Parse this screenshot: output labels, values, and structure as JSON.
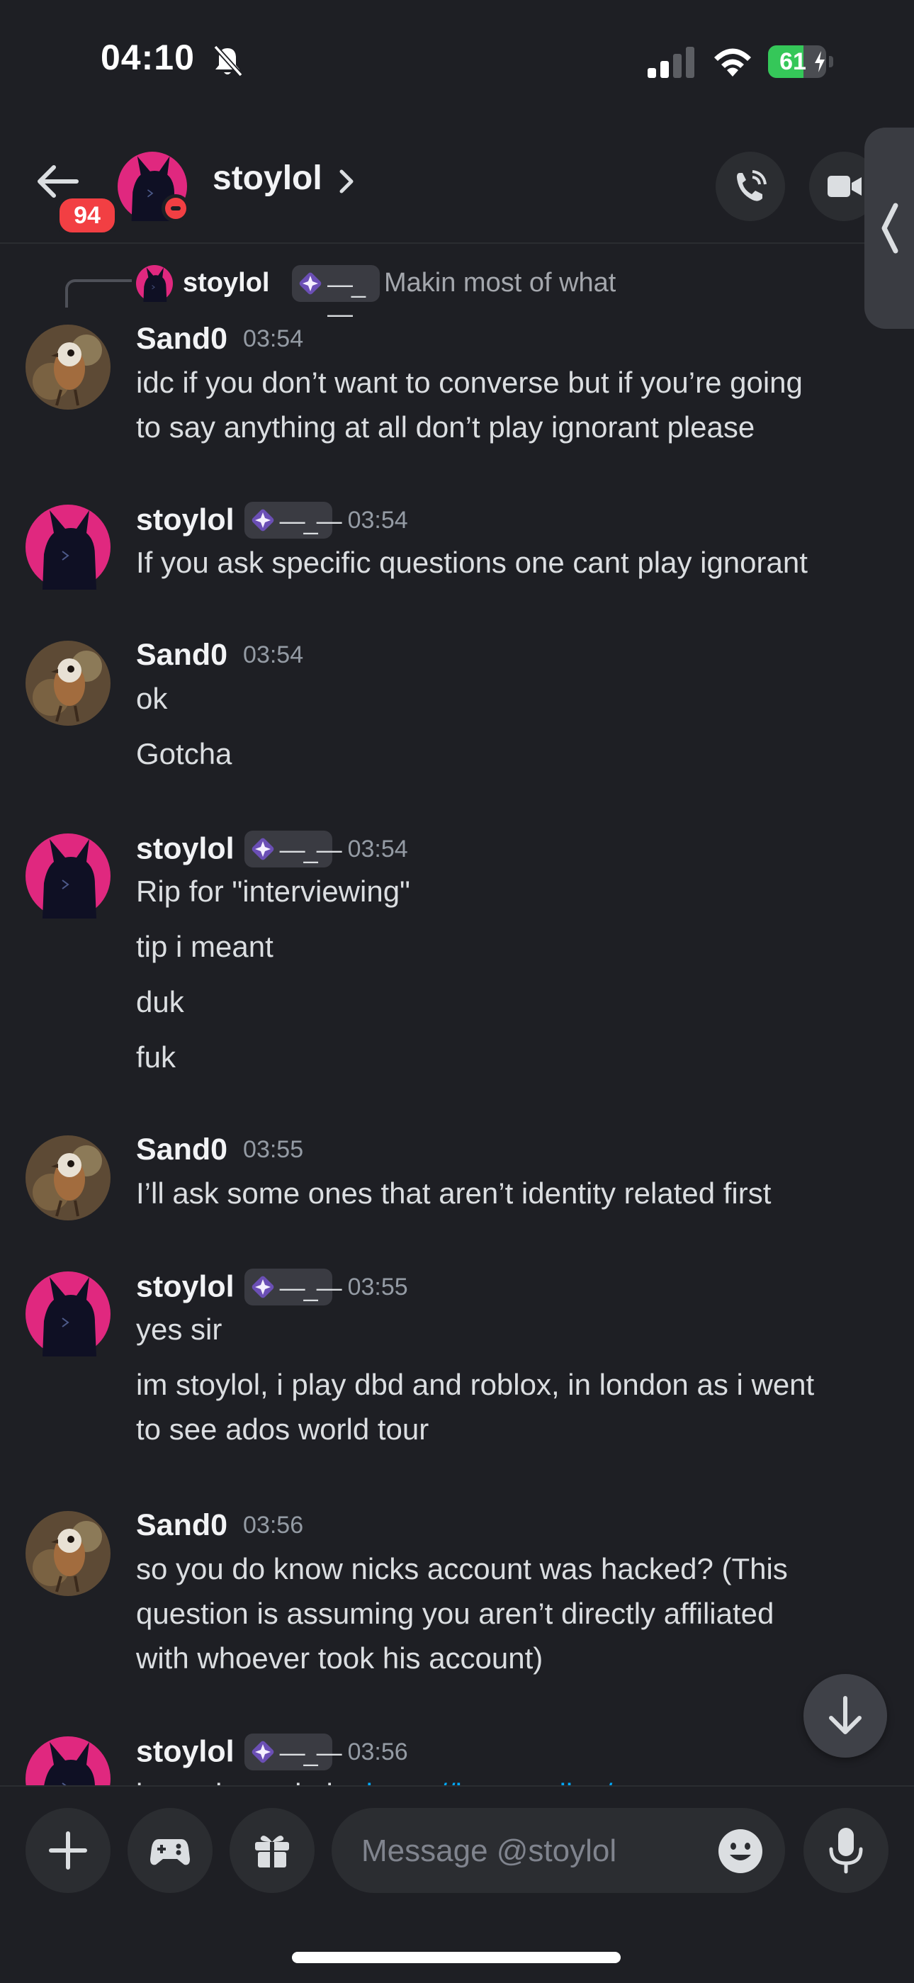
{
  "status_bar": {
    "time": "04:10",
    "battery": "61",
    "battery_level_percent": 61
  },
  "header": {
    "unread_count": "94",
    "username": "stoylol",
    "status": "do-not-disturb",
    "icons": [
      "back-arrow-icon",
      "chevron-right-icon",
      "phone-call-icon",
      "video-camera-icon"
    ]
  },
  "reply_preview": {
    "author": "stoylol",
    "tag": "—_—",
    "text": "Makin most of what"
  },
  "messages": [
    {
      "author": "Sand0",
      "time": "03:54",
      "has_tag": false,
      "lines": [
        "idc if you don’t want to converse but if you’re going",
        "to say anything at all don’t play ignorant please"
      ]
    },
    {
      "author": "stoylol",
      "tag": "—_—",
      "time": "03:54",
      "has_tag": true,
      "lines": [
        "If you ask specific questions one cant play ignorant"
      ]
    },
    {
      "author": "Sand0",
      "time": "03:54",
      "has_tag": false,
      "lines": [
        "ok",
        "Gotcha"
      ]
    },
    {
      "author": "stoylol",
      "tag": "—_—",
      "time": "03:54",
      "has_tag": true,
      "lines": [
        "Rip for \"interviewing\"",
        "tip i meant",
        "duk",
        "fuk"
      ]
    },
    {
      "author": "Sand0",
      "time": "03:55",
      "has_tag": false,
      "lines": [
        "I’ll ask some ones that aren’t identity related first"
      ]
    },
    {
      "author": "stoylol",
      "tag": "—_—",
      "time": "03:55",
      "has_tag": true,
      "lines": [
        "yes sir",
        "im stoylol, i play dbd and roblox, in london as i went",
        "to see ados world tour"
      ]
    },
    {
      "author": "Sand0",
      "time": "03:56",
      "has_tag": false,
      "lines": [
        "so you do know nicks account was hacked? (This",
        "question is assuming you aren’t directly affiliated",
        "with whoever took his account)"
      ]
    },
    {
      "author": "stoylol",
      "tag": "—_—",
      "time": "03:56",
      "has_tag": true,
      "lines": [
        "i use the website ",
        "https://ircoverylinc/"
      ]
    }
  ],
  "composer": {
    "placeholder": "Message @stoylol",
    "icons": [
      "plus-icon",
      "gamepad-icon",
      "gift-icon",
      "emoji-icon",
      "microphone-icon"
    ]
  },
  "colors": {
    "background": "#1e1f24",
    "badge_red": "#f23f43",
    "link": "#00a8fc",
    "battery_green": "#35c759",
    "avatar_pink": "#e0287f"
  }
}
